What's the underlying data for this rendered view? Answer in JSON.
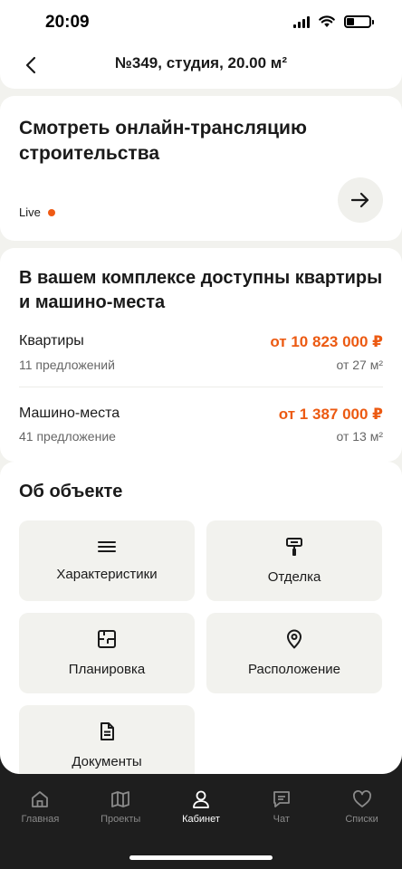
{
  "status_bar": {
    "time": "20:09"
  },
  "header": {
    "title": "№349, студия, 20.00 м²"
  },
  "stream": {
    "title": "Смотреть онлайн-трансляцию строительства",
    "live_label": "Live"
  },
  "offers": {
    "title": "В вашем комплексе доступны квартиры и машино-места",
    "items": [
      {
        "name": "Квартиры",
        "count": "11 предложений",
        "price": "от 10 823 000 ₽",
        "area": "от 27 м²"
      },
      {
        "name": "Машино-места",
        "count": "41 предложение",
        "price": "от 1 387 000 ₽",
        "area": "от 13 м²"
      }
    ]
  },
  "object": {
    "title": "Об объекте",
    "tiles": [
      {
        "label": "Характеристики",
        "icon": "list-icon"
      },
      {
        "label": "Отделка",
        "icon": "paint-roller-icon"
      },
      {
        "label": "Планировка",
        "icon": "floor-plan-icon"
      },
      {
        "label": "Расположение",
        "icon": "location-pin-icon"
      },
      {
        "label": "Документы",
        "icon": "document-icon"
      }
    ]
  },
  "tab_bar": {
    "active": "Кабинет",
    "tabs": [
      {
        "label": "Главная",
        "icon": "home-icon"
      },
      {
        "label": "Проекты",
        "icon": "map-icon"
      },
      {
        "label": "Кабинет",
        "icon": "profile-icon"
      },
      {
        "label": "Чат",
        "icon": "chat-icon"
      },
      {
        "label": "Списки",
        "icon": "heart-icon"
      }
    ]
  },
  "colors": {
    "accent": "#ec5a12",
    "live_dot": "#ef5a14",
    "background": "#f2f2ee"
  }
}
